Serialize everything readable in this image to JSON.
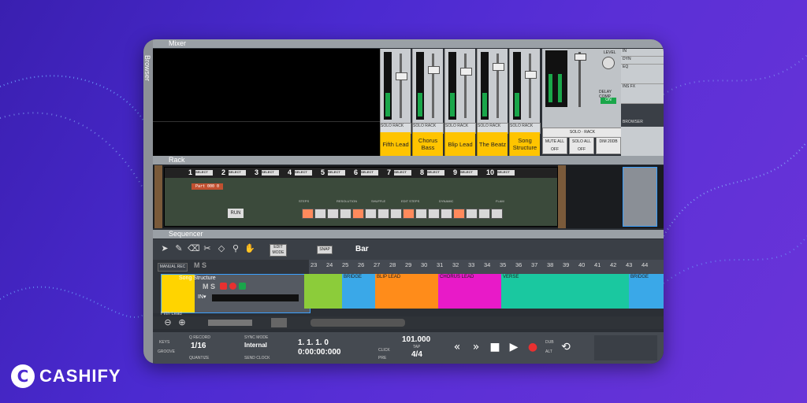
{
  "brand": {
    "logo_letter": "C",
    "name": "CASHIFY"
  },
  "panels": {
    "mixer": "Mixer",
    "browser": "Browser",
    "rack": "Rack",
    "sequencer": "Sequencer"
  },
  "mixer": {
    "channels": [
      "Fifth Lead",
      "Chorus Bass",
      "Blip Lead",
      "The Beatz",
      "Song Structure"
    ],
    "solo_label": "SOLO",
    "rack_label": "RACK",
    "master_buttons": [
      "MUTE ALL OFF",
      "SOLO ALL OFF",
      "DIM 20DB"
    ],
    "level_label": "LEVEL",
    "delay_comp": "DELAY COMP",
    "on": "ON",
    "fx": [
      "IN",
      "DYN",
      "EQ",
      "INS FX"
    ],
    "browser_label": "BROWSER"
  },
  "rack": {
    "slots": [
      "1",
      "2",
      "3",
      "4",
      "5",
      "6",
      "7",
      "8",
      "9",
      "10"
    ],
    "select": "SELECT",
    "patch": "Part 000 0",
    "run": "RUN",
    "labels": [
      "STEPS",
      "RESOLUTION",
      "SHUFFLE",
      "EDIT STEPS",
      "DYNAMIC",
      "FLAM"
    ]
  },
  "sequencer": {
    "edit_mode": "EDIT MODE",
    "snap": "SNAP",
    "snap_value": "Bar",
    "manual_rec": "MANUAL REC",
    "ms": "M S",
    "track_name": "Song Structure",
    "track_name_next": "Fifth Lead",
    "in_label": "IN▾",
    "ruler": [
      "23",
      "24",
      "25",
      "26",
      "27",
      "28",
      "29",
      "30",
      "31",
      "32",
      "33",
      "34",
      "35",
      "36",
      "37",
      "38",
      "39",
      "40",
      "41",
      "42",
      "43",
      "44"
    ],
    "clips": [
      {
        "label": "",
        "color": "#8ccc3a"
      },
      {
        "label": "BRIDGE",
        "color": "#3aa8e8"
      },
      {
        "label": "BLIP LEAD",
        "color": "#ff8c1a"
      },
      {
        "label": "CHORUS LEAD",
        "color": "#e81ac8"
      },
      {
        "label": "VERSE",
        "color": "#1ac8a0"
      },
      {
        "label": "BRIDGE",
        "color": "#3aa8e8"
      }
    ]
  },
  "transport": {
    "keys": "KEYS",
    "groove": "GROOVE",
    "q_record": "Q RECORD",
    "quantize_value": "1/16",
    "quantize": "QUANTIZE",
    "sync_mode": "SYNC MODE",
    "sync_value": "Internal",
    "send_clock": "SEND CLOCK",
    "position": "1.  1.  1.   0",
    "time": "0:00:00:000",
    "click": "CLICK",
    "pre": "PRE",
    "tempo": "101.000",
    "tap": "TAP",
    "signature": "4/4",
    "dub": "DUB",
    "alt": "ALT"
  }
}
